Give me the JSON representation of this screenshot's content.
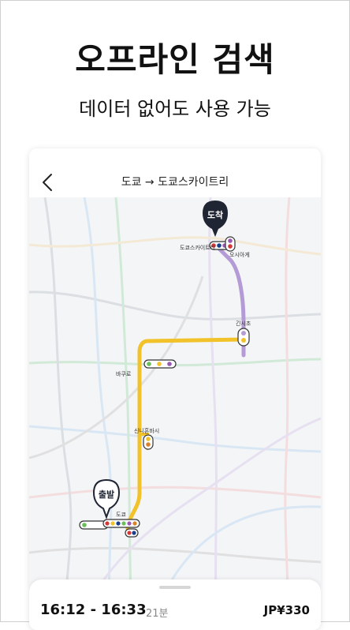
{
  "hero": {
    "title": "오프라인 검색",
    "subtitle": "데이터 없어도 사용 가능"
  },
  "header": {
    "route": "도쿄 → 도쿄스카이트리",
    "back_icon": "chevron-left-icon"
  },
  "map": {
    "arrival_pin": "도착",
    "departure_pin": "출발",
    "stations": {
      "tokyo_skytree": "도쿄스카이트리",
      "oshiage": "오시아게",
      "kinshicho": "긴시초",
      "bakuro": "바쿠로",
      "shin_nihonbashi": "신니혼바시",
      "tokyo": "도쿄"
    },
    "colors": {
      "route_yellow": "#f2c22a",
      "route_purple": "#b49bd6",
      "pin_dark": "#1f2533"
    }
  },
  "summary": {
    "time_range": "16:12 - 16:33",
    "duration": "21분",
    "fare": "JP¥330"
  }
}
